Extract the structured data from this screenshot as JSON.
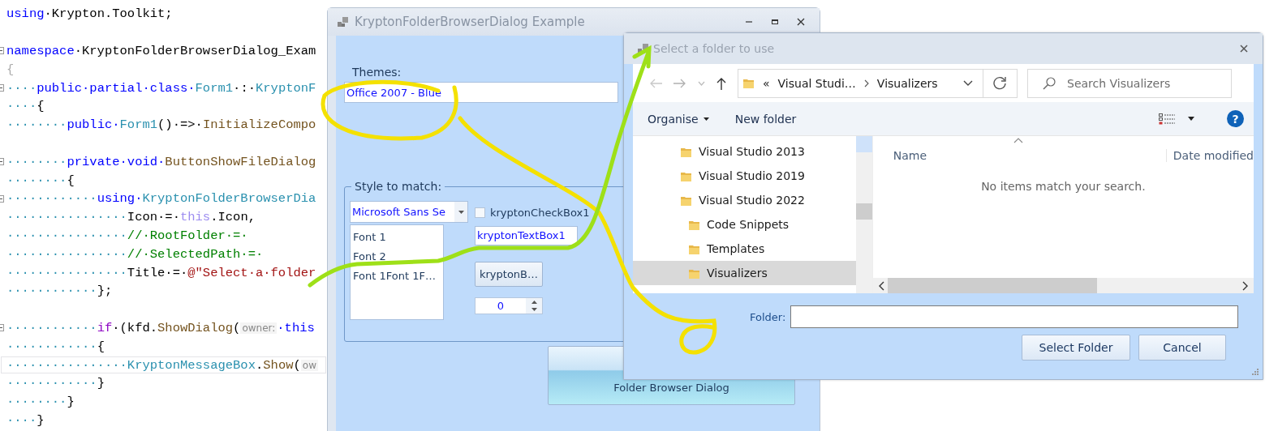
{
  "editor": {
    "lines": [
      {
        "fold": false,
        "current": false,
        "tokens": [
          {
            "kind": "keyword",
            "text": "using"
          },
          {
            "kind": "plain",
            "text": "·Krypton.Toolkit;"
          }
        ]
      },
      {
        "fold": false,
        "current": false
      },
      {
        "fold": true,
        "current": false,
        "tokens": [
          {
            "kind": "keyword",
            "text": "namespace"
          },
          {
            "kind": "plain",
            "text": "·KryptonFolderBrowserDialog_Exam"
          }
        ]
      },
      {
        "fold": false,
        "current": false,
        "tokens": [
          {
            "kind": "faint",
            "text": "{"
          }
        ]
      },
      {
        "fold": true,
        "current": false,
        "tokens": [
          {
            "kind": "ws",
            "text": "····"
          },
          {
            "kind": "keyword",
            "text": "public·partial·class·"
          },
          {
            "kind": "type",
            "text": "Form1"
          },
          {
            "kind": "plain",
            "text": "·:·"
          },
          {
            "kind": "type",
            "text": "KryptonF"
          }
        ]
      },
      {
        "fold": false,
        "current": false,
        "tokens": [
          {
            "kind": "ws",
            "text": "····"
          },
          {
            "kind": "plain",
            "text": "{"
          }
        ]
      },
      {
        "fold": false,
        "current": false,
        "tokens": [
          {
            "kind": "ws",
            "text": "········"
          },
          {
            "kind": "keyword",
            "text": "public·"
          },
          {
            "kind": "type",
            "text": "Form1"
          },
          {
            "kind": "plain",
            "text": "()·=>·"
          },
          {
            "kind": "method",
            "text": "InitializeCompo"
          }
        ]
      },
      {
        "fold": false,
        "current": false
      },
      {
        "fold": true,
        "current": false,
        "tokens": [
          {
            "kind": "ws",
            "text": "········"
          },
          {
            "kind": "keyword",
            "text": "private·void·"
          },
          {
            "kind": "method",
            "text": "ButtonShowFileDialog"
          }
        ]
      },
      {
        "fold": false,
        "current": false,
        "tokens": [
          {
            "kind": "ws",
            "text": "········"
          },
          {
            "kind": "plain",
            "text": "{"
          }
        ]
      },
      {
        "fold": true,
        "current": false,
        "tokens": [
          {
            "kind": "ws",
            "text": "············"
          },
          {
            "kind": "keyword",
            "text": "using·"
          },
          {
            "kind": "type",
            "text": "KryptonFolderBrowserDia"
          }
        ]
      },
      {
        "fold": false,
        "current": false,
        "tokens": [
          {
            "kind": "ws",
            "text": "················"
          },
          {
            "kind": "plain",
            "text": "Icon·=·"
          },
          {
            "kind": "faded",
            "text": "this"
          },
          {
            "kind": "plain",
            "text": ".Icon,"
          }
        ]
      },
      {
        "fold": false,
        "current": false,
        "tokens": [
          {
            "kind": "ws",
            "text": "················"
          },
          {
            "kind": "comment",
            "text": "//·RootFolder·=·"
          }
        ]
      },
      {
        "fold": false,
        "current": false,
        "tokens": [
          {
            "kind": "ws",
            "text": "················"
          },
          {
            "kind": "comment",
            "text": "//·SelectedPath·=·"
          }
        ]
      },
      {
        "fold": false,
        "current": false,
        "tokens": [
          {
            "kind": "ws",
            "text": "················"
          },
          {
            "kind": "plain",
            "text": "Title·=·"
          },
          {
            "kind": "string",
            "text": "@\"Select·a·folder"
          }
        ]
      },
      {
        "fold": false,
        "current": false,
        "tokens": [
          {
            "kind": "ws",
            "text": "············"
          },
          {
            "kind": "plain",
            "text": "};"
          }
        ]
      },
      {
        "fold": false,
        "current": false
      },
      {
        "fold": true,
        "current": false,
        "tokens": [
          {
            "kind": "ws",
            "text": "············"
          },
          {
            "kind": "control",
            "text": "if"
          },
          {
            "kind": "plain",
            "text": "·(kfd."
          },
          {
            "kind": "method",
            "text": "ShowDialog"
          },
          {
            "kind": "plain",
            "text": "("
          },
          {
            "kind": "hint",
            "text": "owner:"
          },
          {
            "kind": "keyword",
            "text": "·this"
          }
        ]
      },
      {
        "fold": false,
        "current": false,
        "tokens": [
          {
            "kind": "ws",
            "text": "············"
          },
          {
            "kind": "plain",
            "text": "{"
          }
        ]
      },
      {
        "fold": false,
        "current": true,
        "tokens": [
          {
            "kind": "ws",
            "text": "················"
          },
          {
            "kind": "type",
            "text": "KryptonMessageBox"
          },
          {
            "kind": "plain",
            "text": "."
          },
          {
            "kind": "method",
            "text": "Show"
          },
          {
            "kind": "plain",
            "text": "("
          },
          {
            "kind": "hint",
            "text": "ow"
          }
        ]
      },
      {
        "fold": false,
        "current": false,
        "tokens": [
          {
            "kind": "ws",
            "text": "············"
          },
          {
            "kind": "plain",
            "text": "}"
          }
        ]
      },
      {
        "fold": false,
        "current": false,
        "tokens": [
          {
            "kind": "ws",
            "text": "········"
          },
          {
            "kind": "plain",
            "text": "}"
          }
        ]
      },
      {
        "fold": false,
        "current": false,
        "tokens": [
          {
            "kind": "ws",
            "text": "····"
          },
          {
            "kind": "plain",
            "text": "}"
          }
        ]
      }
    ]
  },
  "form_window": {
    "title": "KryptonFolderBrowserDialog Example",
    "themes_label": "Themes:",
    "theme_combo": {
      "value": "Office 2007 - Blue"
    },
    "group": {
      "legend": "Style to match:",
      "font_combo": {
        "value": "Microsoft Sans Se"
      },
      "checkbox": {
        "label": "kryptonCheckBox1",
        "checked": false
      },
      "font_list": {
        "items": [
          "Font 1",
          "Font 2",
          "Font 1Font 1F…"
        ]
      },
      "text_box": {
        "value": "kryptonTextBox1"
      },
      "button": {
        "label": "kryptonB…"
      },
      "numeric": {
        "value": "0"
      }
    },
    "main_button": {
      "label": "Folder Browser Dialog"
    }
  },
  "folder_dialog": {
    "title": "Select a folder to use",
    "address": {
      "overflow": "«",
      "path": [
        "Visual Studi…",
        "Visualizers"
      ]
    },
    "search": {
      "placeholder": "Search Visualizers"
    },
    "toolbar": {
      "organise": "Organise",
      "new_folder": "New folder",
      "help": "?"
    },
    "tree": [
      {
        "label": "Visual Studio 2013",
        "selected": false
      },
      {
        "label": "Visual Studio 2019",
        "selected": false
      },
      {
        "label": "Visual Studio 2022",
        "selected": false,
        "children": [
          {
            "label": "Code Snippets",
            "selected": false
          },
          {
            "label": "Templates",
            "selected": false
          },
          {
            "label": "Visualizers",
            "selected": true
          }
        ]
      }
    ],
    "columns": [
      "Name",
      "Date modified"
    ],
    "empty_message": "No items match your search.",
    "folder_label": "Folder:",
    "buttons": [
      "Select Folder",
      "Cancel"
    ]
  }
}
